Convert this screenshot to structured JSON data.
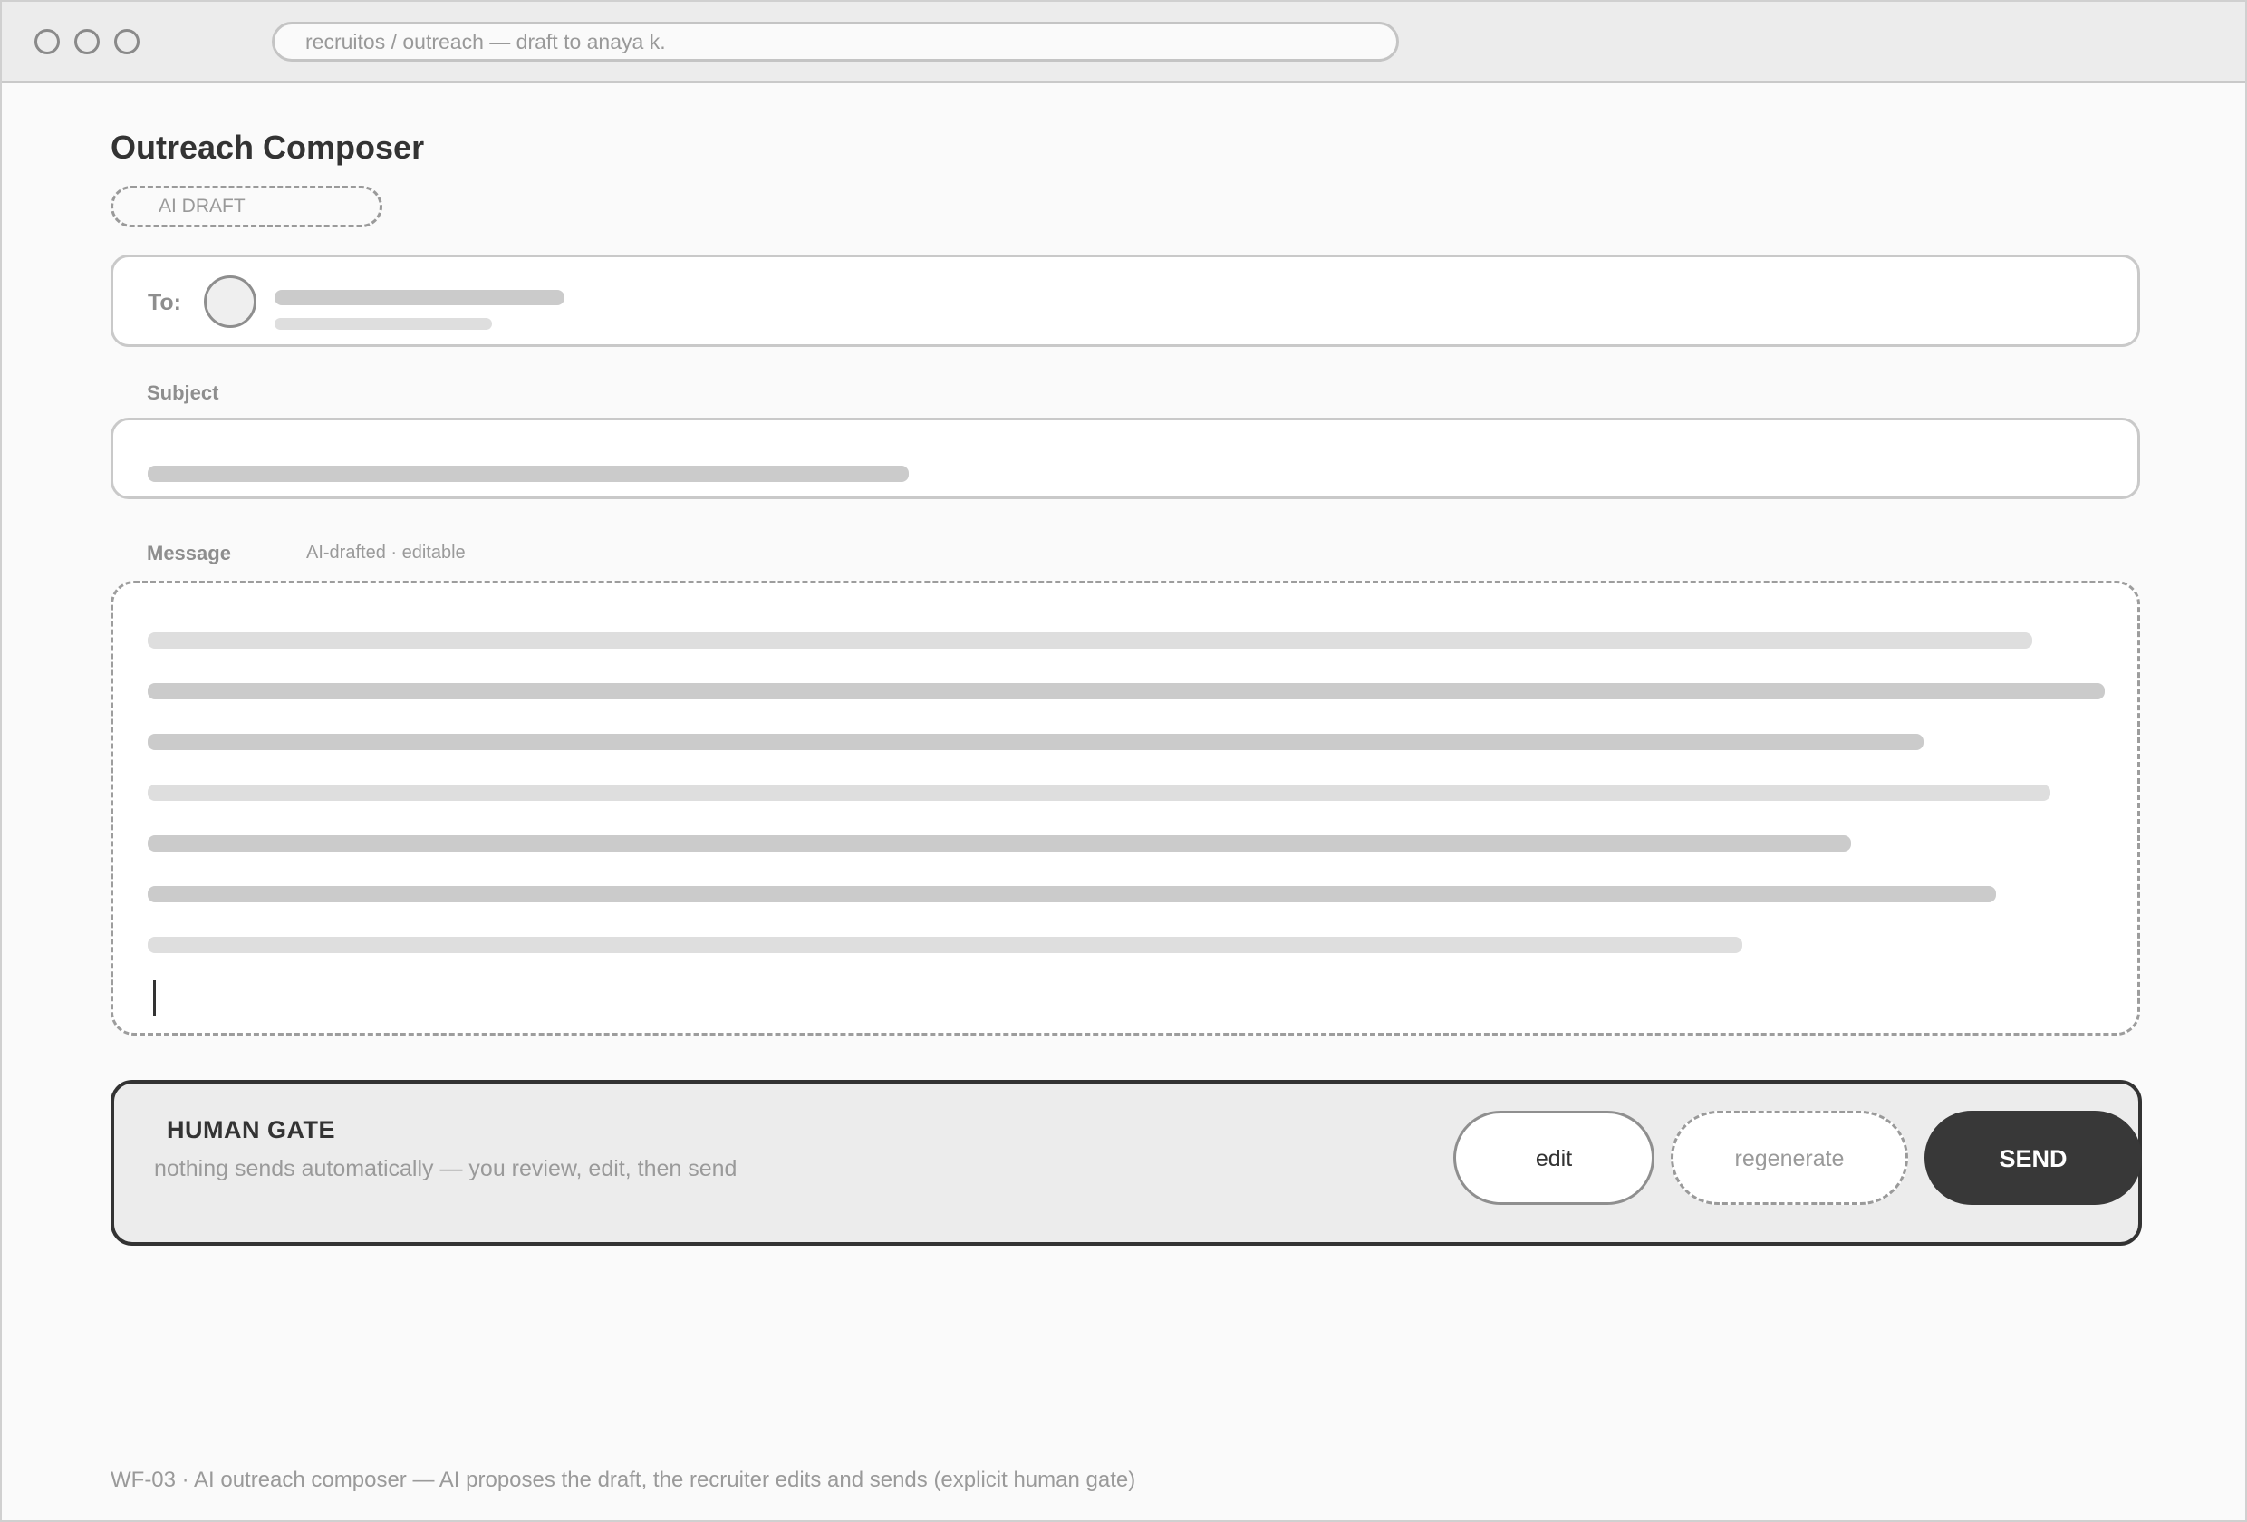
{
  "browser": {
    "url": "recruitos / outreach — draft to anaya k."
  },
  "page": {
    "title": "Outreach Composer",
    "badge": "AI DRAFT"
  },
  "to_field": {
    "label": "To:"
  },
  "subject_field": {
    "label": "Subject"
  },
  "message_field": {
    "label": "Message",
    "hint": "AI-drafted · editable"
  },
  "human_gate": {
    "title": "HUMAN GATE",
    "subtitle": "nothing sends automatically — you review, edit, then send",
    "edit_label": "edit",
    "regenerate_label": "regenerate",
    "send_label": "SEND"
  },
  "footer": {
    "note": "WF-03 · AI outreach composer — AI proposes the draft, the recruiter edits and sends (explicit human gate)"
  },
  "colors": {
    "send_button": "#383838",
    "gate_border": "#333333",
    "skeleton_dark": "#cbcbcb",
    "skeleton_light": "#dedede"
  }
}
